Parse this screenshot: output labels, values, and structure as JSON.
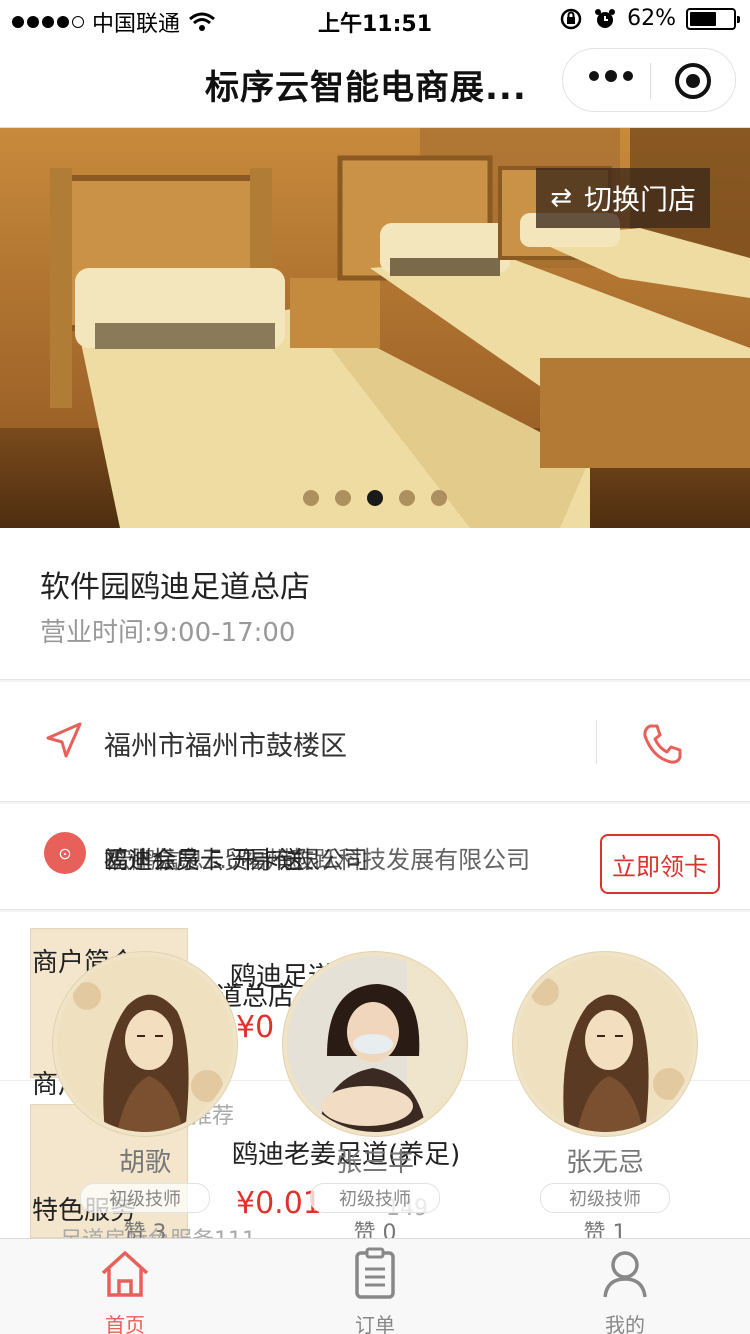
{
  "status_bar": {
    "carrier": "中国联通",
    "time": "上午11:51",
    "battery": "62%",
    "battery_level": 0.62
  },
  "nav": {
    "title": "标序云智能电商展...",
    "more_icon": "more-dots-icon",
    "close_icon": "target-icon"
  },
  "banner": {
    "switch_store_label": "切换门店",
    "switch_icon": "swap-arrows-icon",
    "slide_count": 5,
    "active_slide": 3
  },
  "store": {
    "name": "软件园鸥迪足道总店",
    "hours": "营业时间:9:00-17:00",
    "address": "福州市福州市鼓楼区",
    "location_icon": "navigation-arrow-icon",
    "phone_icon": "phone-icon"
  },
  "membership": {
    "marquee_a": "鸥迪会员卡 开卡送",
    "marquee_b": "福州标序云贸易有限公司",
    "marquee_c": "宏鹏信息 ... 福州鼓跃科技发展有限公司",
    "claim_label": "立即领卡"
  },
  "lower": {
    "merchant_intro": "商户简介",
    "product1_name": "鸥迪足道",
    "product1_sub": "道总店",
    "product1_price": "¥0",
    "section_recommend": "商户",
    "recommend_sub": "推荐",
    "product2_name": "鸥迪老姜足道(养足)",
    "product2_price": "¥0.01",
    "product2_strike": "149",
    "special_service": "特色服务",
    "special_service_item": "足道房特色服务111"
  },
  "technicians": [
    {
      "name": "胡歌",
      "level": "初级技师",
      "likes": "赞 3"
    },
    {
      "name": "张三丰",
      "level": "初级技师",
      "likes": "赞 0"
    },
    {
      "name": "张无忌",
      "level": "初级技师",
      "likes": "赞 1"
    }
  ],
  "tabs": [
    {
      "label": "首页",
      "icon": "home-icon",
      "active": true
    },
    {
      "label": "订单",
      "icon": "clipboard-icon",
      "active": false
    },
    {
      "label": "我的",
      "icon": "user-icon",
      "active": false
    }
  ],
  "colors": {
    "accent": "#e8605a",
    "price_red": "#e0322a",
    "claim_red": "#d9332e"
  }
}
